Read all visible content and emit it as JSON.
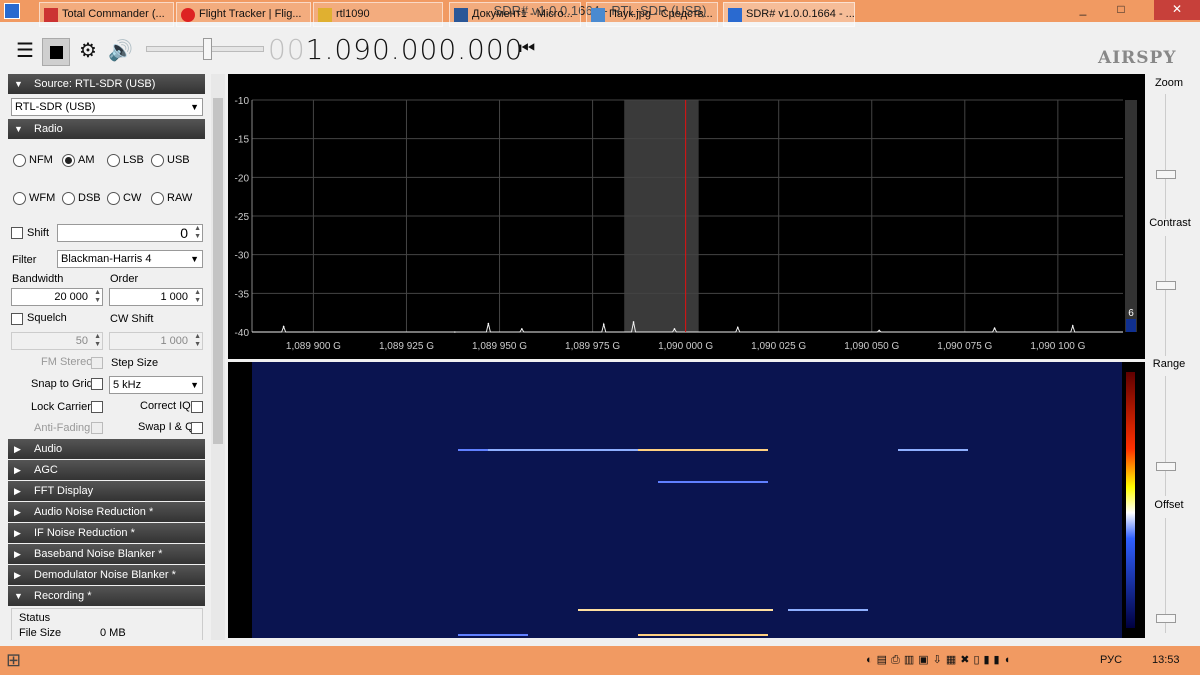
{
  "window": {
    "title": "SDR# v1.0.0.1664 - RTL-SDR (USB)",
    "min": "_",
    "max": "□",
    "close": "✕"
  },
  "toolbar": {
    "menu_icon": "hamburger-icon",
    "gear_icon": "gear-icon",
    "speaker_icon": "speaker-icon",
    "volume": 0.5,
    "freq_dim": "00",
    "freq": "1.090.000.000",
    "tune_icon": "⏮",
    "logo": "AIRSPY"
  },
  "left": {
    "source_header": "Source: RTL-SDR (USB)",
    "source_value": "RTL-SDR (USB)",
    "radio_header": "Radio",
    "modes": [
      "NFM",
      "AM",
      "LSB",
      "USB",
      "WFM",
      "DSB",
      "CW",
      "RAW"
    ],
    "mode_selected": "AM",
    "shift_label": "Shift",
    "shift_value": "0",
    "filter_label": "Filter",
    "filter_value": "Blackman-Harris 4",
    "bandwidth_label": "Bandwidth",
    "bandwidth_value": "20 000",
    "order_label": "Order",
    "order_value": "1 000",
    "squelch_label": "Squelch",
    "squelch_value": "50",
    "cwshift_label": "CW Shift",
    "cwshift_value": "1 000",
    "fmstereo_label": "FM Stereo",
    "stepsize_label": "Step Size",
    "snap_label": "Snap to Grid",
    "step_value": "5 kHz",
    "lockcarrier_label": "Lock Carrier",
    "correctiq_label": "Correct IQ",
    "antifading_label": "Anti-Fading",
    "swapiq_label": "Swap I & Q",
    "panels": [
      "Audio",
      "AGC",
      "FFT Display",
      "Audio Noise Reduction *",
      "IF Noise Reduction *",
      "Baseband Noise Blanker *",
      "Demodulator Noise Blanker *",
      "Recording *"
    ],
    "status_label": "Status",
    "filesize_label": "File Size",
    "filesize_value": "0 MB"
  },
  "chart_data": {
    "type": "line",
    "title": "",
    "xlabel": "",
    "ylabel": "",
    "x_ticks": [
      "1,089 900 G",
      "1,089 925 G",
      "1,089 950 G",
      "1,089 975 G",
      "1,090 000 G",
      "1,090 025 G",
      "1,090 050 G",
      "1,090 075 G",
      "1,090 100 G"
    ],
    "y_ticks": [
      "-10",
      "-15",
      "-20",
      "-25",
      "-30",
      "-35",
      "-40"
    ],
    "ylim": [
      -40,
      -10
    ],
    "peaks_x": [
      1089.892,
      1089.938,
      1089.947,
      1089.956,
      1089.978,
      1089.986,
      1089.997,
      1090.014,
      1090.052,
      1090.083,
      1090.104
    ],
    "peaks_y": [
      -39.3,
      -40,
      -38.9,
      -39.6,
      -39.0,
      -38.7,
      -39.6,
      -39.4,
      -39.8,
      -39.5,
      -39.2
    ],
    "center": "1,090 000 G",
    "level_label": "6"
  },
  "right": {
    "zoom": "Zoom",
    "contrast": "Contrast",
    "range": "Range",
    "offset": "Offset"
  },
  "taskbar": {
    "items": [
      "Total Commander (...",
      "Flight Tracker | Flig...",
      "rtl1090",
      "Документ1 - Micro...",
      "Паук.jpg - Средств...",
      "SDR# v1.0.0.1664 - ..."
    ],
    "lang": "РУС",
    "time": "13:53"
  }
}
